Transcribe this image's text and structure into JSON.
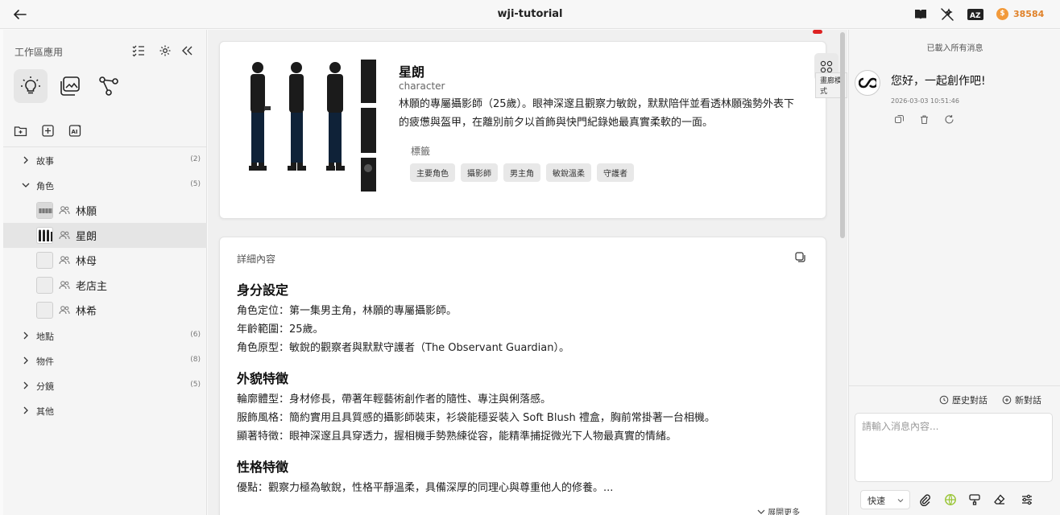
{
  "topbar": {
    "title": "wji-tutorial",
    "credits": "38584",
    "coin_symbol": "$",
    "icons": [
      "back-arrow-icon",
      "book-icon",
      "magic-off-icon",
      "translate-icon",
      "coin-icon"
    ]
  },
  "sidebar": {
    "title": "工作區應用",
    "tree": {
      "story": {
        "label": "故事",
        "count": "(2)"
      },
      "character": {
        "label": "角色",
        "count": "(5)"
      },
      "location": {
        "label": "地點",
        "count": "(6)"
      },
      "item": {
        "label": "物件",
        "count": "(8)"
      },
      "storyboard": {
        "label": "分鏡",
        "count": "(5)"
      },
      "other": {
        "label": "其他"
      }
    },
    "characters": [
      "林願",
      "星朗",
      "林母",
      "老店主",
      "林希"
    ]
  },
  "main": {
    "character": {
      "name": "星朗",
      "type": "character",
      "description": "林願的專屬攝影師（25歲）。眼神深邃且觀察力敏銳，默默陪伴並看透林願強勢外表下的疲憊與盔甲，在離別前夕以首飾與快門紀錄她最真實柔軟的一面。",
      "tags_label": "標籤",
      "tags": [
        "主要角色",
        "攝影師",
        "男主角",
        "敏銳溫柔",
        "守護者"
      ]
    },
    "gallery_tooltip": "畫廊模式",
    "detail": {
      "heading": "詳細內容",
      "sections": [
        {
          "title": "身分設定",
          "lines": [
            "角色定位：第一集男主角，林願的專屬攝影師。",
            "年齡範圍：25歲。",
            "角色原型：敏銳的觀察者與默默守護者（The Observant Guardian）。"
          ]
        },
        {
          "title": "外貌特徵",
          "lines": [
            "輪廓體型：身材修長，帶著年輕藝術創作者的隨性、專注與俐落感。",
            "服飾風格：簡約實用且具質感的攝影師裝束，衫袋能穩妥裝入 Soft Blush 禮盒，胸前常掛著一台相機。",
            "顯著特徵：眼神深邃且具穿透力，握相機手勢熟練從容，能精準捕捉微光下人物最真實的情緒。"
          ]
        },
        {
          "title": "性格特徵",
          "lines": [
            "優點：觀察力極為敏銳，性格平靜溫柔，具備深厚的同理心與尊重他人的修養。..."
          ]
        }
      ],
      "expand_label": "展開更多"
    }
  },
  "chat": {
    "loaded_label": "已載入所有消息",
    "message": "您好，一起創作吧!",
    "timestamp": "2026-03-03 10:51:46",
    "history_label": "歷史對話",
    "new_chat_label": "新對話",
    "input_placeholder": "請輸入消息內容...",
    "speed_label": "快速"
  }
}
